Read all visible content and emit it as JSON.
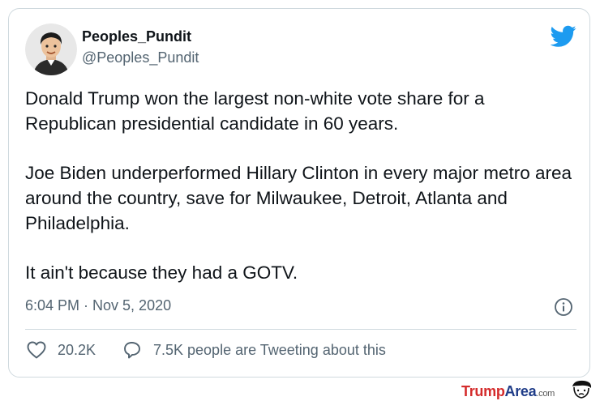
{
  "tweet": {
    "display_name": "Peoples_Pundit",
    "handle": "@Peoples_Pundit",
    "paragraphs": [
      "Donald Trump won the largest non-white vote share for a Republican presidential candidate in 60 years.",
      "Joe Biden underperformed Hillary Clinton in every major metro area around the country, save for Milwaukee, Detroit, Atlanta and Philadelphia.",
      "It ain't because they had a GOTV."
    ],
    "timestamp": "6:04 PM · Nov 5, 2020",
    "likes": "20.2K",
    "conversation": "7.5K people are Tweeting about this"
  },
  "icons": {
    "logo": "twitter-bird-icon",
    "like": "heart-icon",
    "conversation": "speech-bubble-icon",
    "info": "info-icon"
  },
  "colors": {
    "twitter_blue": "#1d9bf0",
    "text_primary": "#0f1419",
    "text_secondary": "#536471",
    "border": "#cfd9de",
    "brand_red": "#d42c2c",
    "brand_blue": "#1f3c88"
  },
  "watermark": {
    "part1": "Trump",
    "part2": "Area",
    "part3": ".com"
  }
}
